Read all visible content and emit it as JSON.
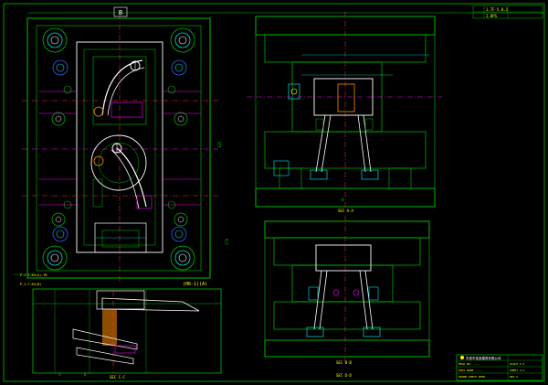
{
  "colors": {
    "background": "#000000",
    "outline": "#00c000",
    "bright": "#ffffff",
    "cyan": "#00e0e0",
    "magenta": "#ff00ff",
    "red": "#ff3030",
    "yellow": "#ffff00",
    "orange": "#ff8c00",
    "blue": "#3060ff"
  },
  "labels": {
    "top_tag": "B",
    "title_box_row1": "1.TF-5.8.1",
    "title_box_row2": "2.DPS",
    "section_a": "SEC A-A",
    "section_b": "SEC B-B",
    "section_c": "SEC C-C",
    "section_d": "SEC D-D",
    "plan_caption": "(H6-1)(A)",
    "note_left": "P.I-T-KS(A)-TB",
    "note_left2": "P.I-T-KS(B)",
    "dim_side": "135",
    "dim_right": "270",
    "view_label": "B",
    "small_tag_a": "A",
    "small_tag_b": "B"
  },
  "title_block": {
    "company": "东莞市某某模具有限公司",
    "rows": [
      "MOLD NO.  ----",
      "PART NAME  ----",
      "DRAWN  CHECK  APPR"
    ],
    "side_rows": [
      "SCALE 1:1",
      "SHEET 1/1",
      "REV A"
    ]
  }
}
